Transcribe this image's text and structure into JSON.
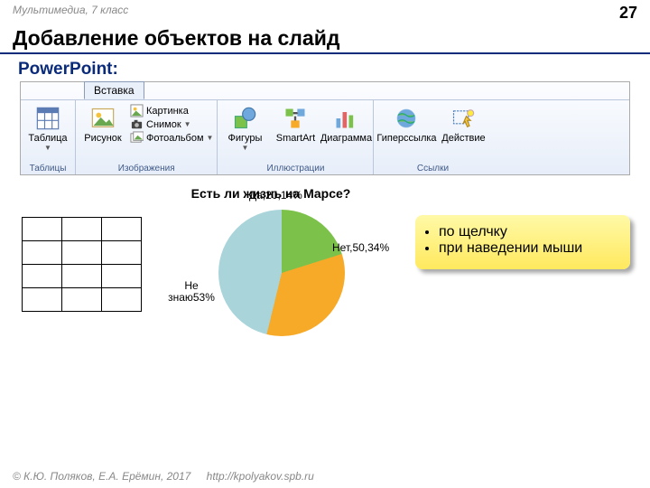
{
  "header": {
    "context": "Мультимедиа, 7 класс",
    "page": "27"
  },
  "title": "Добавление объектов на слайд",
  "subtitle": "PowerPoint:",
  "ribbon": {
    "tab": "Вставка",
    "groups": {
      "tables": {
        "label": "Таблицы",
        "table_btn": "Таблица"
      },
      "images": {
        "label": "Изображения",
        "picture_btn": "Рисунок",
        "clipart": "Картинка",
        "screenshot": "Снимок",
        "album": "Фотоальбом"
      },
      "illustrations": {
        "label": "Иллюстрации",
        "shapes": "Фигуры",
        "smartart": "SmartArt",
        "chart": "Диаграмма"
      },
      "links": {
        "label": "Ссылки",
        "hyperlink": "Гиперссылка",
        "action": "Действие"
      }
    }
  },
  "chart_data": {
    "type": "pie",
    "title": "Есть ли жизнь на Марсе?",
    "series": [
      {
        "name": "Да",
        "value": 20.14,
        "label": "Да,20,14%"
      },
      {
        "name": "Нет",
        "value": 50.34,
        "label": "Нет,50,34%"
      },
      {
        "name": "Не знаю",
        "value": 53,
        "label": "Не знаю53%"
      }
    ]
  },
  "callout": {
    "items": [
      "по щелчку",
      "при наведении мыши"
    ]
  },
  "footer": {
    "copyright": "© К.Ю. Поляков, Е.А. Ерёмин, 2017",
    "url": "http://kpolyakov.spb.ru"
  }
}
